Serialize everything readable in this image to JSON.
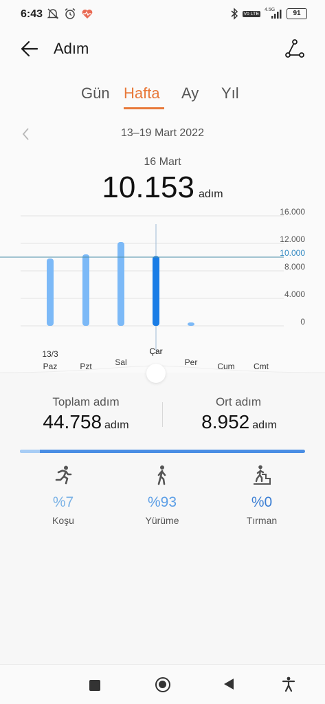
{
  "status_bar": {
    "time": "6:43",
    "network": "4.5G",
    "volte": "Vo LTE",
    "battery": "91",
    "icons_left": [
      "muted-bell-icon",
      "alarm-clock-icon",
      "heart-rate-icon"
    ],
    "icons_right": [
      "bluetooth-icon",
      "volte-icon",
      "signal-icon",
      "battery-icon"
    ]
  },
  "header": {
    "title": "Adım",
    "back_icon": "arrow-left-icon",
    "share_icon": "share-nodes-icon"
  },
  "tabs": [
    {
      "label": "Gün",
      "active": false
    },
    {
      "label": "Hafta",
      "active": true
    },
    {
      "label": "Ay",
      "active": false
    },
    {
      "label": "Yıl",
      "active": false
    }
  ],
  "date_range": "13–19 Mart 2022",
  "selected": {
    "date": "16 Mart",
    "value": "10.153",
    "unit": "adım"
  },
  "chart_data": {
    "type": "bar",
    "categories": [
      "Paz",
      "Pzt",
      "Sal",
      "Çar",
      "Per",
      "Cum",
      "Cmt"
    ],
    "date_label": "13/3",
    "values": [
      9800,
      10400,
      12200,
      10153,
      500,
      0,
      0
    ],
    "selected_index": 3,
    "y_ticks": [
      "16.000",
      "12.000",
      "8.000",
      "4.000",
      "0"
    ],
    "yticks_values": [
      16000,
      12000,
      8000,
      4000,
      0
    ],
    "ylim": [
      0,
      16000
    ],
    "average_line": {
      "value": 10000,
      "label": "10.000"
    },
    "colors": {
      "bar": "#7cb9f7",
      "selected_bar": "#1a7de6",
      "average_line": "#4a8fa8",
      "grid": "#e3e3e3"
    }
  },
  "stats": {
    "total_label": "Toplam adım",
    "total_value": "44.758",
    "total_unit": "adım",
    "avg_label": "Ort adım",
    "avg_value": "8.952",
    "avg_unit": "adım"
  },
  "progress": {
    "running_fraction": 0.07
  },
  "activities": [
    {
      "pct": "%7",
      "label": "Koşu",
      "icon": "running-icon",
      "color": "#7ab2e6"
    },
    {
      "pct": "%93",
      "label": "Yürüme",
      "icon": "walking-icon",
      "color": "#5b9ee6"
    },
    {
      "pct": "%0",
      "label": "Tırman",
      "icon": "climbing-icon",
      "color": "#3c7fd4"
    }
  ],
  "navbar": {
    "items": [
      "square-icon",
      "home-circle-icon",
      "back-triangle-icon",
      "accessibility-icon"
    ]
  },
  "colors": {
    "accent": "#e8793a",
    "blue": "#1a7de6"
  }
}
